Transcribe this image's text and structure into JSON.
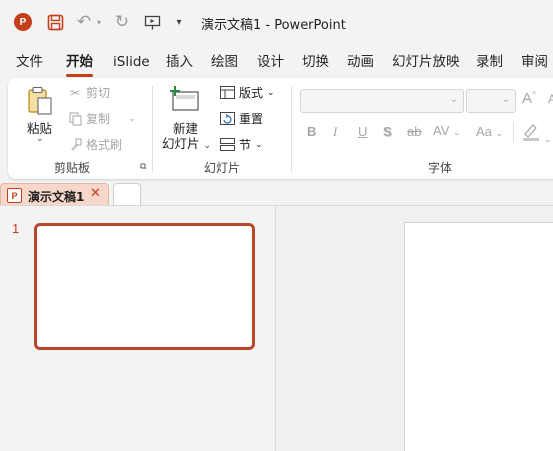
{
  "titlebar": {
    "app_logo": "P",
    "title": "演示文稿1  -  PowerPoint",
    "icons": [
      "powerpoint-logo-icon",
      "save-icon",
      "undo-icon",
      "redo-icon",
      "present-from-start-icon",
      "customize-qat-icon"
    ]
  },
  "ribbon_tabs": [
    "文件",
    "开始",
    "iSlide",
    "插入",
    "绘图",
    "设计",
    "切换",
    "动画",
    "幻灯片放映",
    "录制",
    "审阅"
  ],
  "active_tab": "开始",
  "clipboard": {
    "paste": "粘贴",
    "cut": "剪切",
    "copy": "复制",
    "format_painter": "格式刷",
    "group_label": "剪贴板"
  },
  "slides_group": {
    "new_slide_line1": "新建",
    "new_slide_line2": "幻灯片",
    "layout": "版式",
    "reset": "重置",
    "section": "节",
    "group_label": "幻灯片"
  },
  "font_group": {
    "font_name_value": "",
    "font_size_value": "",
    "grow": "A",
    "shrink": "A",
    "bold": "B",
    "italic": "I",
    "underline": "U",
    "shadow": "S",
    "strikethrough": "ab",
    "spacing": "AV",
    "change_case": "Aa",
    "group_label": "字体"
  },
  "document_tab": {
    "icon": "P",
    "label": "演示文稿1",
    "close": "✕"
  },
  "thumbnail": {
    "slide_number": "1"
  },
  "colors": {
    "accent": "#c43e1c",
    "thumbnail_border": "#b7472a",
    "doc_tab_bg": "#f7d7c9",
    "window_bg": "#f3f3f3"
  }
}
